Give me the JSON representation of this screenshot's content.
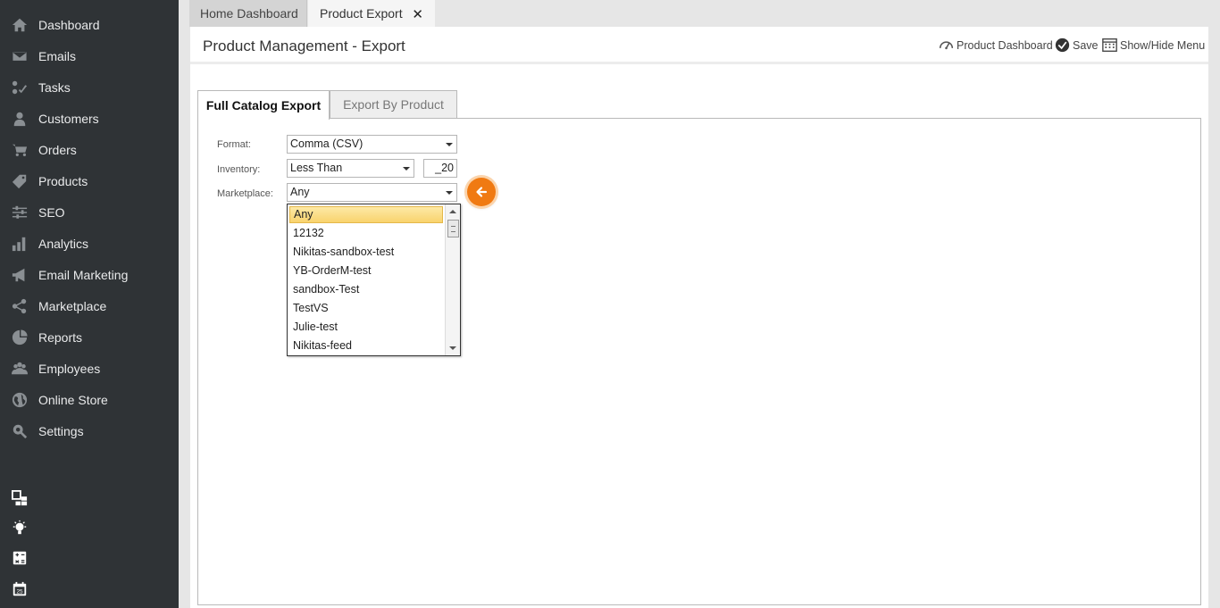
{
  "sidebar": {
    "items": [
      {
        "label": "Dashboard",
        "icon": "home-icon"
      },
      {
        "label": "Emails",
        "icon": "envelope-icon"
      },
      {
        "label": "Tasks",
        "icon": "tasks-icon"
      },
      {
        "label": "Customers",
        "icon": "user-icon"
      },
      {
        "label": "Orders",
        "icon": "cart-icon"
      },
      {
        "label": "Products",
        "icon": "tag-icon"
      },
      {
        "label": "SEO",
        "icon": "sliders-icon"
      },
      {
        "label": "Analytics",
        "icon": "bar-chart-icon"
      },
      {
        "label": "Email Marketing",
        "icon": "megaphone-icon"
      },
      {
        "label": "Marketplace",
        "icon": "share-icon"
      },
      {
        "label": "Reports",
        "icon": "pie-chart-icon"
      },
      {
        "label": "Employees",
        "icon": "users-icon"
      },
      {
        "label": "Online Store",
        "icon": "globe-icon"
      },
      {
        "label": "Settings",
        "icon": "gear-search-icon"
      }
    ],
    "bottom_icons": [
      "widgets-icon",
      "lightbulb-icon",
      "calculator-icon",
      "calendar-icon"
    ]
  },
  "tabs": {
    "home": "Home Dashboard",
    "product_export": "Product Export",
    "close_glyph": "✕"
  },
  "header": {
    "title": "Product Management - Export",
    "actions": {
      "dashboard": "Product Dashboard",
      "save": "Save",
      "menu": "Show/Hide Menu"
    }
  },
  "section_tabs": {
    "full": "Full Catalog Export",
    "by_product": "Export By Product"
  },
  "form": {
    "format_label": "Format:",
    "format_value": "Comma (CSV)",
    "inventory_label": "Inventory:",
    "inventory_op": "Less Than",
    "inventory_qty": "_20",
    "marketplace_label": "Marketplace:",
    "marketplace_value": "Any"
  },
  "dropdown": {
    "options": [
      "Any",
      "12132",
      "Nikitas-sandbox-test",
      "YB-OrderM-test",
      "sandbox-Test",
      "TestVS",
      "Julie-test",
      "Nikitas-feed"
    ],
    "selected_index": 0
  },
  "colors": {
    "sidebar_bg": "#2f3336",
    "accent_orange": "#f07a12",
    "highlight": "#f9d36d"
  }
}
